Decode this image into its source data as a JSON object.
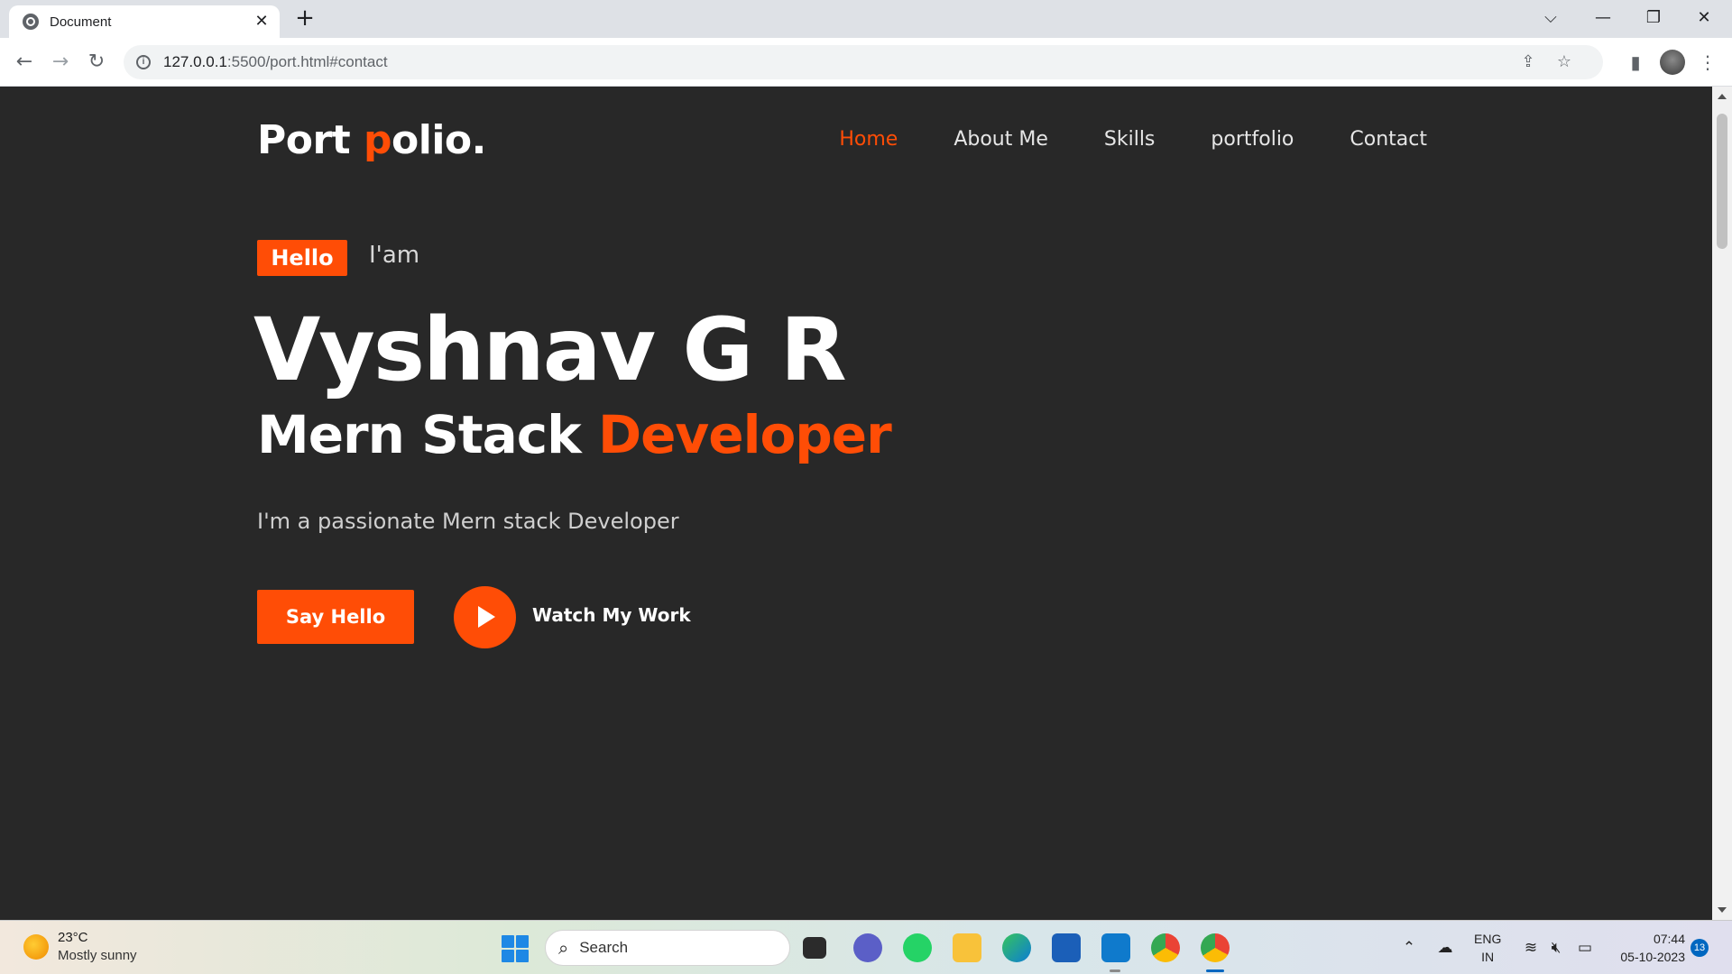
{
  "browser": {
    "tab_title": "Document",
    "tab_close": "✕",
    "new_tab": "+",
    "url_host": "127.0.0.1",
    "url_rest": ":5500/port.html#contact",
    "window_controls": {
      "collapse": "⌵",
      "minimize": "—",
      "restore": "❐",
      "close": "✕"
    },
    "icons": [
      "back-icon",
      "forward-icon",
      "reload-icon",
      "info-icon",
      "share-icon",
      "star-icon",
      "side-panel-icon",
      "profile-avatar",
      "kebab-menu-icon"
    ]
  },
  "page": {
    "logo_main": "Port ",
    "logo_accent": "p",
    "logo_rest": "olio.",
    "nav": [
      {
        "label": "Home",
        "active": true
      },
      {
        "label": "About Me",
        "active": false
      },
      {
        "label": "Skills",
        "active": false
      },
      {
        "label": "portfolio",
        "active": false
      },
      {
        "label": "Contact",
        "active": false
      }
    ],
    "hello_badge": "Hello",
    "iam": "I'am",
    "name": "Vyshnav G R",
    "title_main": "Mern Stack ",
    "title_accent": "Developer",
    "tagline": "I'm a passionate Mern stack Developer",
    "cta_primary": "Say Hello",
    "cta_secondary": "Watch My Work",
    "colors": {
      "accent": "#ff4d06",
      "background": "#282828",
      "text": "#ffffff"
    }
  },
  "taskbar": {
    "weather_temp": "23°C",
    "weather_desc": "Mostly sunny",
    "search_label": "Search",
    "apps": [
      "task-view",
      "teams-chat",
      "whatsapp",
      "file-explorer",
      "edge",
      "microsoft-store",
      "vscode",
      "chrome",
      "chrome-profile"
    ],
    "lang_top": "ENG",
    "lang_bottom": "IN",
    "time": "07:44",
    "date": "05-10-2023",
    "notifications": "13"
  }
}
